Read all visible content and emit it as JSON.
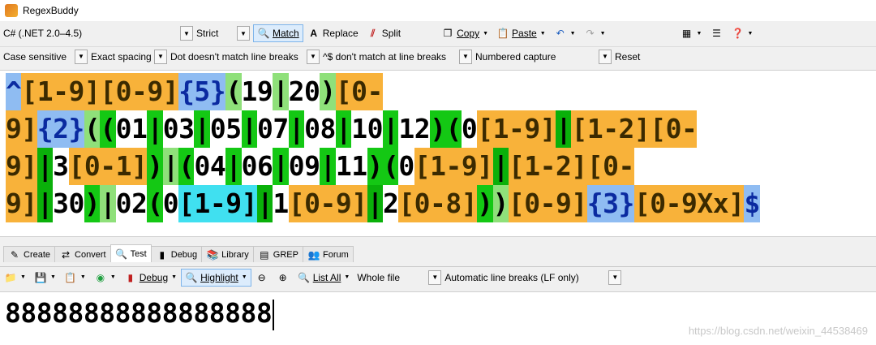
{
  "window": {
    "title": "RegexBuddy"
  },
  "toolbar1": {
    "flavor": "C# (.NET 2.0–4.5)",
    "mode": "Strict",
    "match": "Match",
    "replace": "Replace",
    "split": "Split",
    "copy": "Copy",
    "paste": "Paste"
  },
  "toolbar2": {
    "case": "Case sensitive",
    "spacing": "Exact spacing",
    "dot": "Dot doesn't match line breaks",
    "anchors": "^$ don't match at line breaks",
    "capture": "Numbered capture",
    "reset": "Reset"
  },
  "regex_lines": [
    [
      {
        "t": "^",
        "c": "c-blue"
      },
      {
        "t": "[1-9]",
        "c": "c-orange"
      },
      {
        "t": "[0-9]",
        "c": "c-orange"
      },
      {
        "t": "{5}",
        "c": "c-blue"
      },
      {
        "t": "(",
        "c": "c-lgreen"
      },
      {
        "t": "19",
        "c": "c-white"
      },
      {
        "t": "|",
        "c": "c-lgreen"
      },
      {
        "t": "20",
        "c": "c-white"
      },
      {
        "t": ")",
        "c": "c-lgreen"
      },
      {
        "t": "[0-",
        "c": "c-orange"
      }
    ],
    [
      {
        "t": "9]",
        "c": "c-orange"
      },
      {
        "t": "{2}",
        "c": "c-blue"
      },
      {
        "t": "(",
        "c": "c-lgreen"
      },
      {
        "t": "(",
        "c": "c-green"
      },
      {
        "t": "01",
        "c": "c-white"
      },
      {
        "t": "|",
        "c": "c-green"
      },
      {
        "t": "03",
        "c": "c-white"
      },
      {
        "t": "|",
        "c": "c-green"
      },
      {
        "t": "05",
        "c": "c-white"
      },
      {
        "t": "|",
        "c": "c-green"
      },
      {
        "t": "07",
        "c": "c-white"
      },
      {
        "t": "|",
        "c": "c-green"
      },
      {
        "t": "08",
        "c": "c-white"
      },
      {
        "t": "|",
        "c": "c-green"
      },
      {
        "t": "10",
        "c": "c-white"
      },
      {
        "t": "|",
        "c": "c-green"
      },
      {
        "t": "12",
        "c": "c-white"
      },
      {
        "t": ")",
        "c": "c-green"
      },
      {
        "t": "(",
        "c": "c-green"
      },
      {
        "t": "0",
        "c": "c-white"
      },
      {
        "t": "[1-9]",
        "c": "c-orange"
      },
      {
        "t": "|",
        "c": "c-dgreen"
      },
      {
        "t": "[1-2]",
        "c": "c-orange"
      },
      {
        "t": "[0-",
        "c": "c-orange"
      }
    ],
    [
      {
        "t": "9]",
        "c": "c-orange"
      },
      {
        "t": "|",
        "c": "c-dgreen"
      },
      {
        "t": "3",
        "c": "c-white"
      },
      {
        "t": "[0-1]",
        "c": "c-orange"
      },
      {
        "t": ")",
        "c": "c-green"
      },
      {
        "t": "|",
        "c": "c-lgreen"
      },
      {
        "t": "(",
        "c": "c-green"
      },
      {
        "t": "04",
        "c": "c-white"
      },
      {
        "t": "|",
        "c": "c-green"
      },
      {
        "t": "06",
        "c": "c-white"
      },
      {
        "t": "|",
        "c": "c-green"
      },
      {
        "t": "09",
        "c": "c-white"
      },
      {
        "t": "|",
        "c": "c-green"
      },
      {
        "t": "11",
        "c": "c-white"
      },
      {
        "t": ")",
        "c": "c-green"
      },
      {
        "t": "(",
        "c": "c-green"
      },
      {
        "t": "0",
        "c": "c-white"
      },
      {
        "t": "[1-9]",
        "c": "c-orange"
      },
      {
        "t": "|",
        "c": "c-dgreen"
      },
      {
        "t": "[1-2]",
        "c": "c-orange"
      },
      {
        "t": "[0-",
        "c": "c-orange"
      }
    ],
    [
      {
        "t": "9]",
        "c": "c-orange"
      },
      {
        "t": "|",
        "c": "c-dgreen"
      },
      {
        "t": "30",
        "c": "c-white"
      },
      {
        "t": ")",
        "c": "c-green"
      },
      {
        "t": "|",
        "c": "c-lgreen"
      },
      {
        "t": "02",
        "c": "c-white"
      },
      {
        "t": "(",
        "c": "c-green"
      },
      {
        "t": "0",
        "c": "c-white"
      },
      {
        "t": "[1-9]",
        "c": "c-cyan"
      },
      {
        "t": "|",
        "c": "c-dgreen"
      },
      {
        "t": "1",
        "c": "c-white"
      },
      {
        "t": "[0-9]",
        "c": "c-orange"
      },
      {
        "t": "|",
        "c": "c-dgreen"
      },
      {
        "t": "2",
        "c": "c-white"
      },
      {
        "t": "[0-8]",
        "c": "c-orange"
      },
      {
        "t": ")",
        "c": "c-green"
      },
      {
        "t": ")",
        "c": "c-lgreen"
      },
      {
        "t": "[0-9]",
        "c": "c-orange"
      },
      {
        "t": "{3}",
        "c": "c-blue"
      },
      {
        "t": "[0-9Xx]",
        "c": "c-orange"
      },
      {
        "t": "$",
        "c": "c-blue"
      }
    ]
  ],
  "tabs": [
    "Create",
    "Convert",
    "Test",
    "Debug",
    "Library",
    "GREP",
    "Forum"
  ],
  "active_tab": "Test",
  "toolbar3": {
    "debug": "Debug",
    "highlight": "Highlight",
    "list_all": "List All",
    "scope": "Whole file",
    "line_breaks": "Automatic line breaks (LF only)"
  },
  "test_text": "88888888888888888",
  "watermark": "https://blog.csdn.net/weixin_44538469"
}
